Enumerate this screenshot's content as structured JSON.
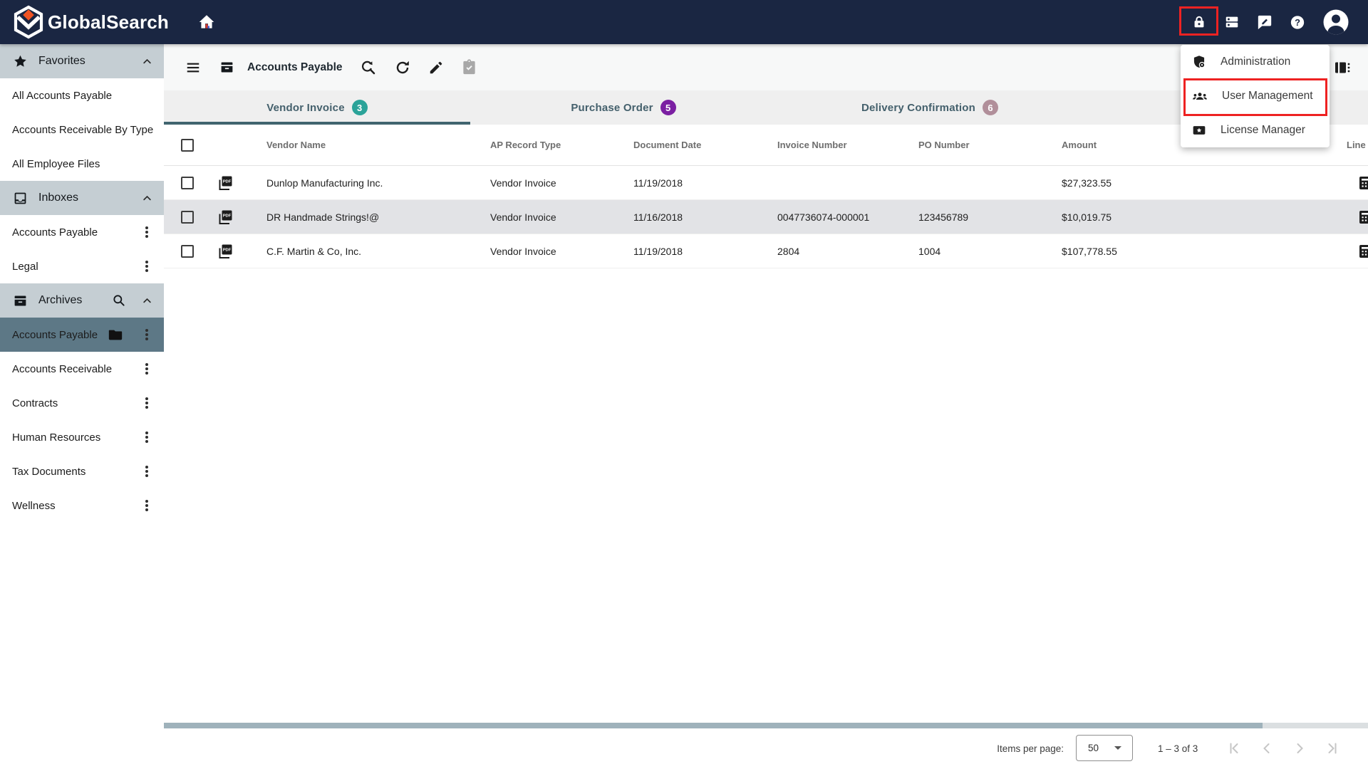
{
  "navbar": {
    "brand": "GlobalSearch"
  },
  "sidebar": {
    "sections": [
      {
        "label": "Favorites",
        "items": [
          {
            "label": "All Accounts Payable"
          },
          {
            "label": "Accounts Receivable By Type"
          },
          {
            "label": "All Employee Files"
          }
        ]
      },
      {
        "label": "Inboxes",
        "items": [
          {
            "label": "Accounts Payable"
          },
          {
            "label": "Legal"
          }
        ]
      },
      {
        "label": "Archives",
        "items": [
          {
            "label": "Accounts Payable",
            "selected": true
          },
          {
            "label": "Accounts Receivable"
          },
          {
            "label": "Contracts"
          },
          {
            "label": "Human Resources"
          },
          {
            "label": "Tax Documents"
          },
          {
            "label": "Wellness"
          }
        ]
      }
    ]
  },
  "toolbar": {
    "title": "Accounts Payable"
  },
  "tabs": [
    {
      "label": "Vendor Invoice",
      "count": "3",
      "color": "#2ba399",
      "active": true
    },
    {
      "label": "Purchase Order",
      "count": "5",
      "color": "#7b1fa2",
      "active": false
    },
    {
      "label": "Delivery Confirmation",
      "count": "6",
      "color": "#b18f9a",
      "active": false
    }
  ],
  "table": {
    "columns": [
      "Vendor Name",
      "AP Record Type",
      "Document Date",
      "Invoice Number",
      "PO Number",
      "Amount",
      "Line Items"
    ],
    "rows": [
      {
        "vendor": "Dunlop Manufacturing Inc.",
        "type": "Vendor Invoice",
        "date": "11/19/2018",
        "invoice": "",
        "po": "",
        "amount": "$27,323.55"
      },
      {
        "vendor": "DR Handmade Strings!@",
        "type": "Vendor Invoice",
        "date": "11/16/2018",
        "invoice": "0047736074-000001",
        "po": "123456789",
        "amount": "$10,019.75",
        "highlighted": true
      },
      {
        "vendor": "C.F. Martin & Co, Inc.",
        "type": "Vendor Invoice",
        "date": "11/19/2018",
        "invoice": "2804",
        "po": "1004",
        "amount": "$107,778.55"
      }
    ]
  },
  "menu": {
    "items": [
      {
        "label": "Administration"
      },
      {
        "label": "User Management",
        "highlighted": true
      },
      {
        "label": "License Manager"
      }
    ]
  },
  "footer": {
    "items_per_page_label": "Items per page:",
    "page_size": "50",
    "range": "1 – 3 of 3"
  },
  "colors": {
    "navbar": "#1a2642",
    "section_header": "#c5ced3",
    "selected_item": "#5d7886",
    "active_tab_underline": "#40646f",
    "highlight_box": "#ee2222",
    "badge_teal": "#2ba399",
    "badge_purple": "#7b1fa2",
    "badge_mauve": "#b18f9a"
  }
}
